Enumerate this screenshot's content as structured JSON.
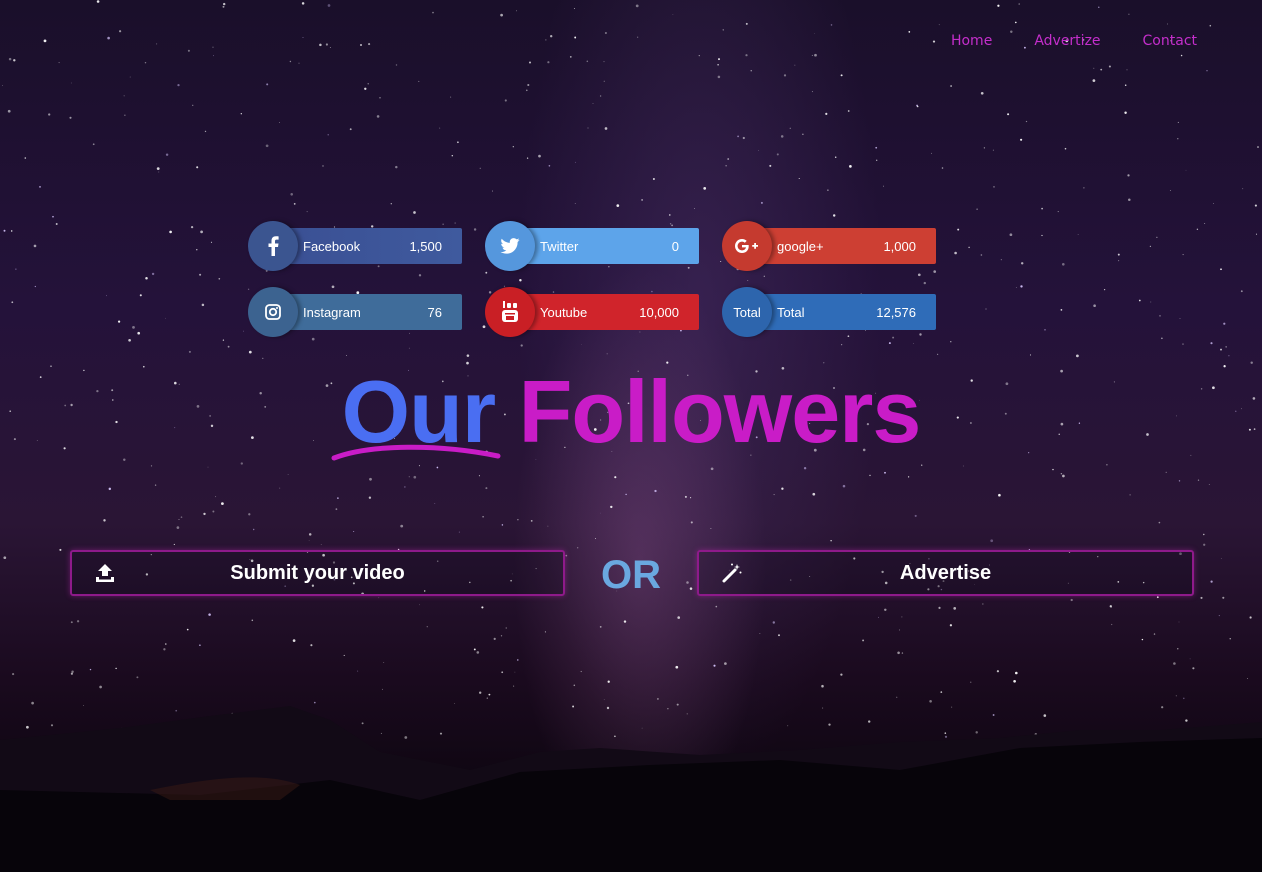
{
  "nav": {
    "items": [
      "Home",
      "Advertize",
      "Contact"
    ]
  },
  "social": [
    {
      "key": "fb",
      "icon": "facebook-icon",
      "label": "Facebook",
      "count": "1,500",
      "color": "#3b5998"
    },
    {
      "key": "tw",
      "icon": "twitter-icon",
      "label": "Twitter",
      "count": "0",
      "color": "#5da4ea"
    },
    {
      "key": "gp",
      "icon": "google-plus-icon",
      "label": "google+",
      "count": "1,000",
      "color": "#cd3f33"
    },
    {
      "key": "ig",
      "icon": "instagram-icon",
      "label": "Instagram",
      "count": "76",
      "color": "#3f6c9a"
    },
    {
      "key": "yt",
      "icon": "youtube-icon",
      "label": "Youtube",
      "count": "10,000",
      "color": "#d0242b"
    },
    {
      "key": "tt",
      "icon": "total-text",
      "icon_text": "Total",
      "label": "Total",
      "count": "12,576",
      "color": "#2f6cb8"
    }
  ],
  "heading": {
    "word1": "Our",
    "word2": "Followers",
    "color1": "#4a6ef2",
    "color2": "#c91cc7"
  },
  "actions": {
    "submit_label": "Submit your video",
    "separator": "OR",
    "advertise_label": "Advertise"
  }
}
